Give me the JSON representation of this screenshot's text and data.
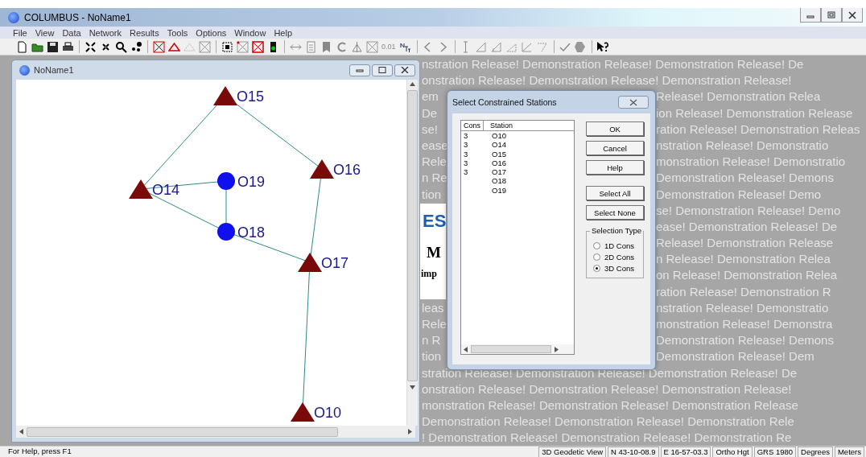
{
  "window": {
    "title": "COLUMBUS - NoName1"
  },
  "menu": [
    "File",
    "View",
    "Data",
    "Network",
    "Results",
    "Tools",
    "Options",
    "Window",
    "Help"
  ],
  "toolbar_text": [
    "0.01"
  ],
  "child_window": {
    "title": "NoName1"
  },
  "network": {
    "nodes": [
      {
        "label": "O15",
        "kind": "triangle"
      },
      {
        "label": "O16",
        "kind": "triangle"
      },
      {
        "label": "O14",
        "kind": "triangle"
      },
      {
        "label": "O19",
        "kind": "circle"
      },
      {
        "label": "O18",
        "kind": "circle"
      },
      {
        "label": "O17",
        "kind": "triangle"
      },
      {
        "label": "O10",
        "kind": "triangle"
      }
    ]
  },
  "background_logo": [
    "ES",
    "M",
    "imp"
  ],
  "watermark_top": [
    "nstration Release!  Demonstration Release!  Demonstration Release!  De",
    "onstration Release!  Demonstration Release!  Demonstration Release!"
  ],
  "watermark_middle": [
    {
      "left": "em",
      "right": "Release!  Demonstration Relea"
    },
    {
      "left": "De",
      "right": "ion Release!  Demonstration Release"
    },
    {
      "left": "se!",
      "right": "ration Release!  Demonstration Releas"
    },
    {
      "left": "ease",
      "right": "nstration Release!  Demonstratio"
    },
    {
      "left": "Rele",
      "right": "monstration Release!  Demonstratio"
    },
    {
      "left": "n Re",
      "right": "Demonstration Release!  Demons"
    },
    {
      "left": "tion",
      "right": "Demonstration Release!  Demo"
    },
    {
      "right": "se!  Demonstration Release!  Demo"
    },
    {
      "right": "ease!  Demonstration Release!  De"
    },
    {
      "right": "Release!  Demonstration Release"
    },
    {
      "right": "n Release!  Demonstration Relea"
    },
    {
      "right": "on Release!  Demonstration Relea"
    },
    {
      "right": "ration Release!  Demonstration R"
    },
    {
      "left": "leas",
      "right": "nstration Release!  Demonstratio"
    },
    {
      "left": "Rele",
      "right": "monstration Release!  Demonstra"
    },
    {
      "left": "n R",
      "right": "Demonstration Release!  Demons"
    },
    {
      "left": "tion",
      "right": "Demonstration Release!  Dem"
    }
  ],
  "watermark_bottom": [
    "stration Release!  Demonstration Release!  Demonstration Release!  De",
    "onstration Release!  Demonstration Release!  Demonstration Release!",
    "monstration Release!  Demonstration Release!  Demonstration Release",
    "Demonstration Release!  Demonstration Release!  Demonstration Rele",
    "!  Demonstration Release!  Demonstration Release!  Demonstration Re"
  ],
  "dialog": {
    "title": "Select Constrained Stations",
    "columns": [
      "Cons",
      "Station"
    ],
    "rows": [
      {
        "cons": "3",
        "station": "O10"
      },
      {
        "cons": "3",
        "station": "O14"
      },
      {
        "cons": "3",
        "station": "O15"
      },
      {
        "cons": "3",
        "station": "O16"
      },
      {
        "cons": "3",
        "station": "O17"
      },
      {
        "station": "O18"
      },
      {
        "station": "O19"
      }
    ],
    "buttons": [
      "OK",
      "Cancel",
      "Help"
    ],
    "select_buttons": [
      "Select All",
      "Select None"
    ],
    "selection_type": {
      "label": "Selection Type",
      "options": [
        {
          "label": "1D Cons",
          "selected": false
        },
        {
          "label": "2D Cons",
          "selected": false
        },
        {
          "label": "3D Cons",
          "selected": true
        }
      ]
    }
  },
  "status_bar": {
    "help": "For Help, press F1",
    "panes": [
      "3D Geodetic View",
      "N 43-10-08.9",
      "E 16-57-03.3",
      "Ortho Hgt",
      "GRS 1980",
      "Degrees",
      "Meters"
    ]
  }
}
